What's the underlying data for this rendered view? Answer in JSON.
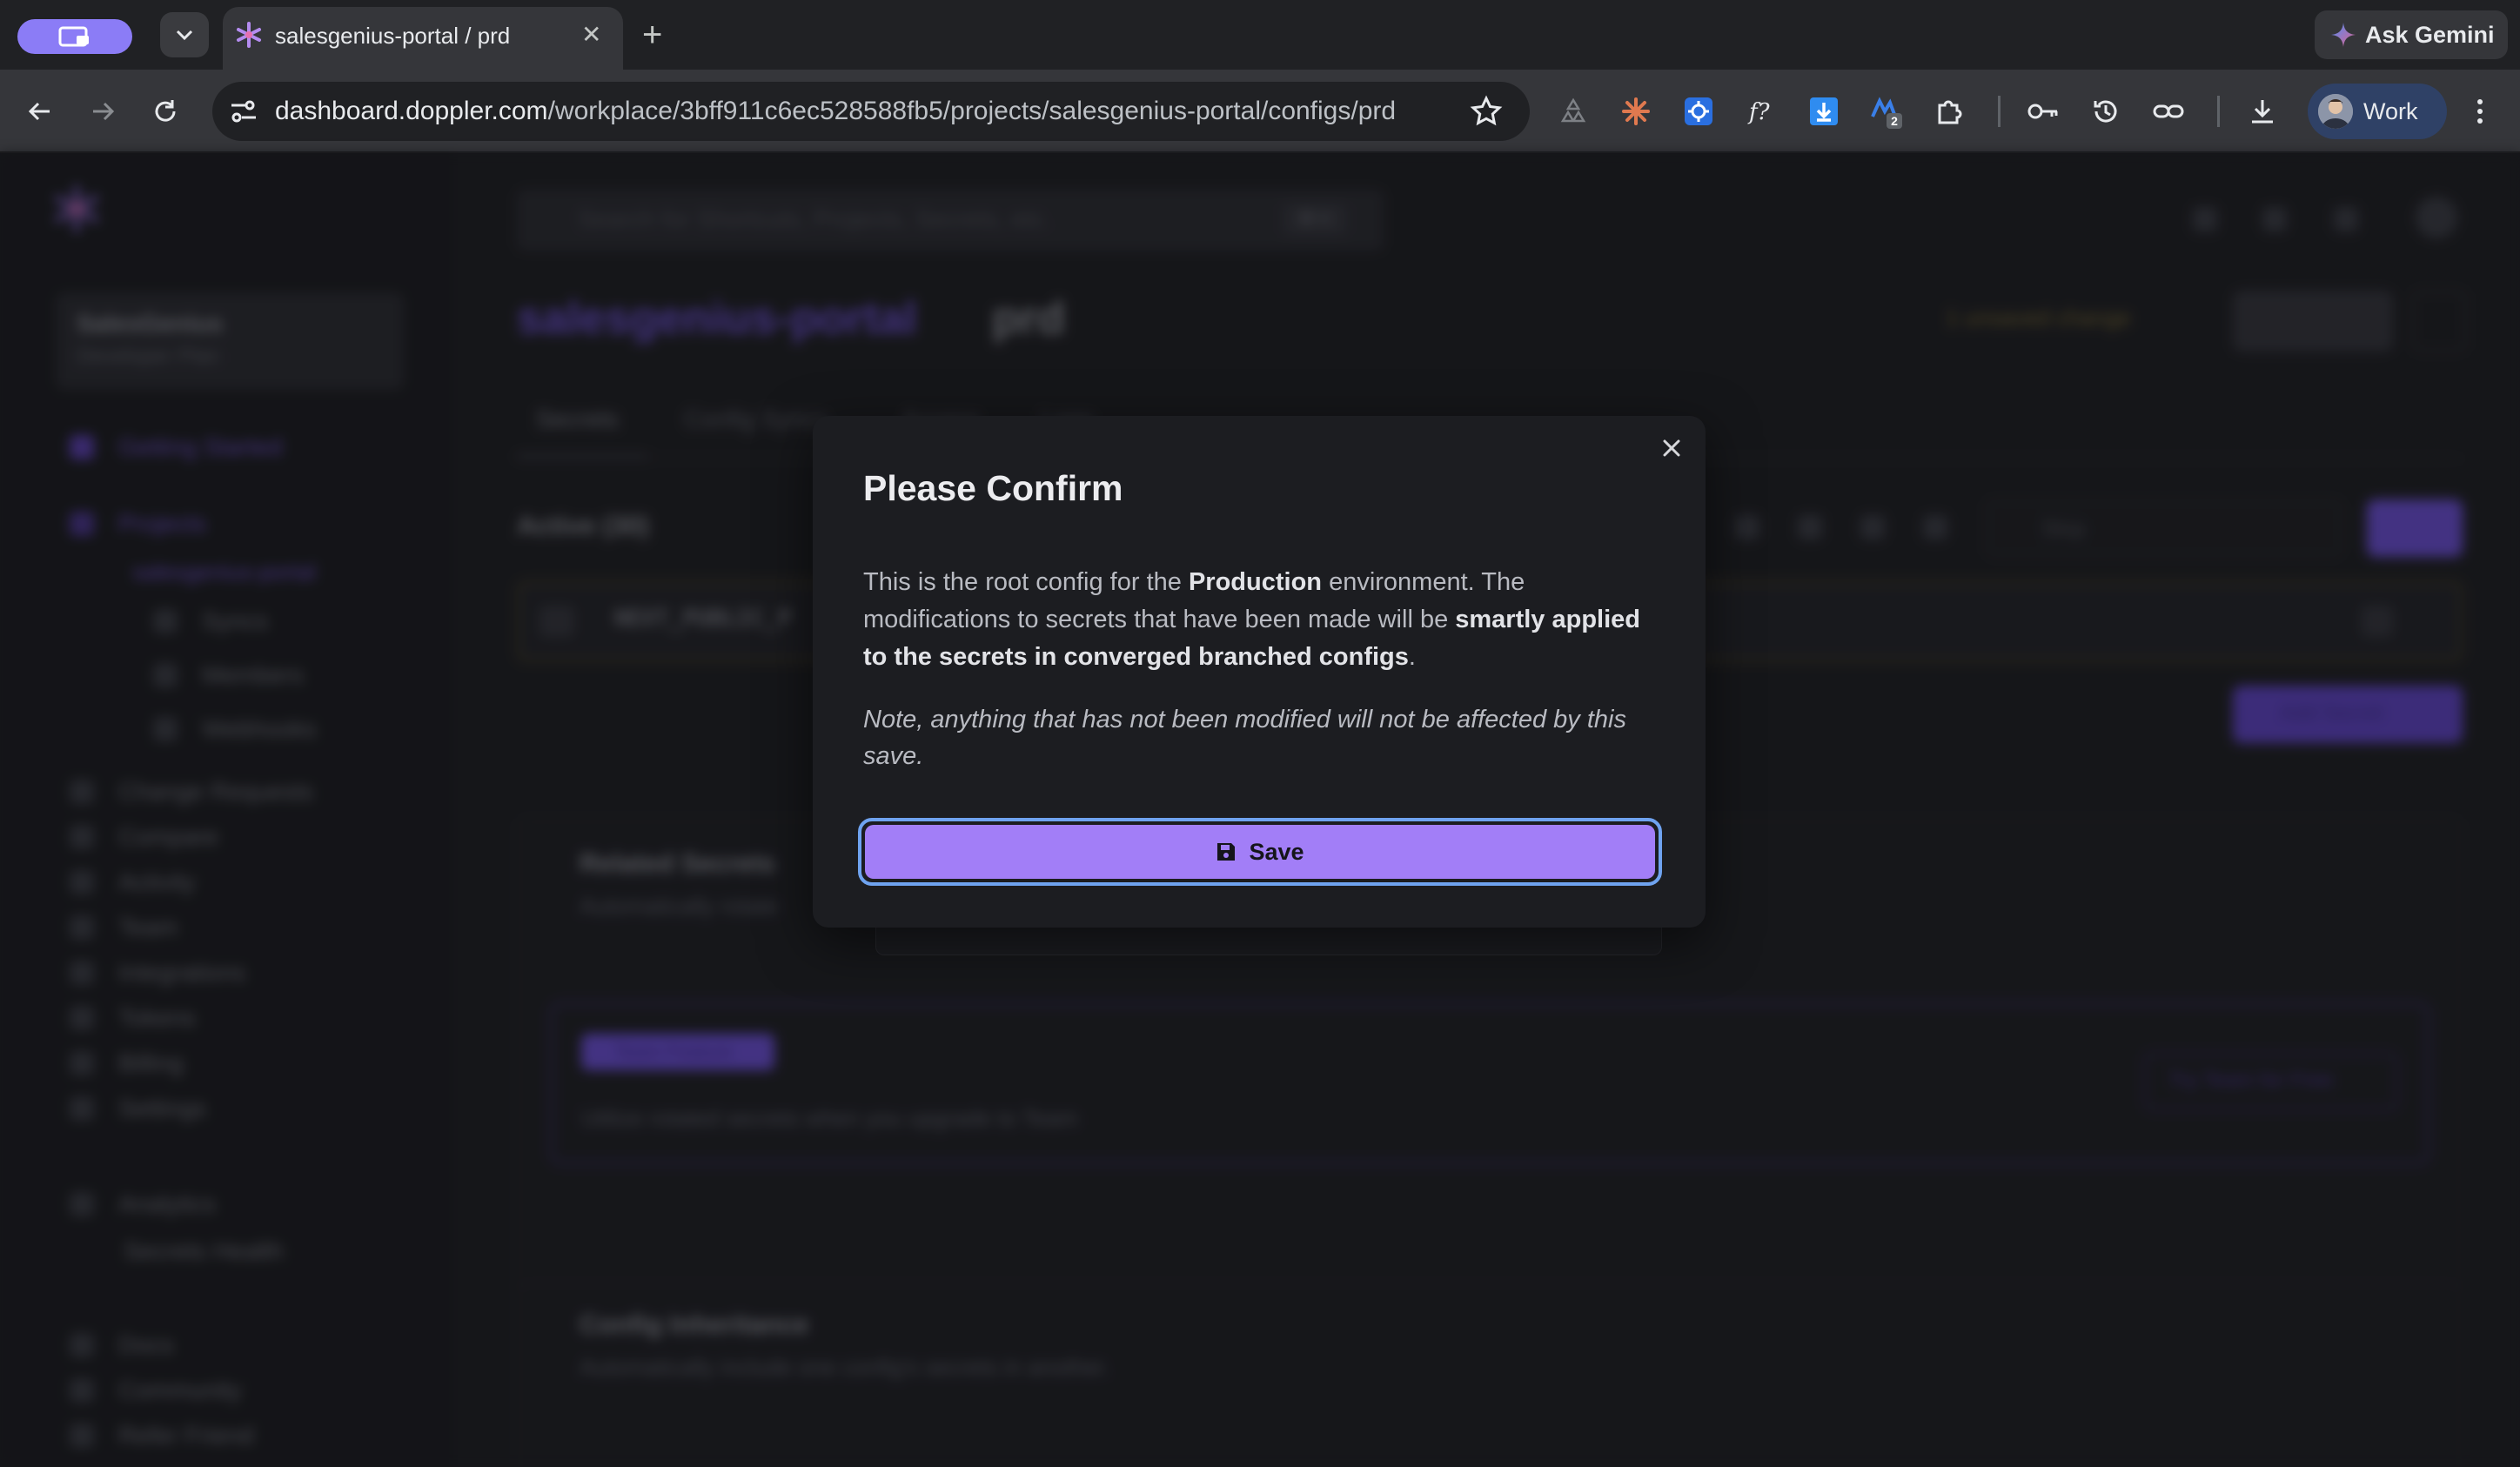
{
  "browser": {
    "tab": {
      "title": "salesgenius-portal / prd",
      "close_glyph": "✕"
    },
    "new_tab_glyph": "+",
    "gemini": {
      "label": "Ask Gemini"
    },
    "url": {
      "host": "dashboard.doppler.com",
      "path": "/workplace/3bff911c6ec528588fb5/projects/salesgenius-portal/configs/prd"
    },
    "profile": {
      "label": "Work"
    },
    "extension_badge": "2"
  },
  "app": {
    "search_placeholder": "Search for Shortcuts, Projects, Secrets, etc.",
    "search_shortcut": "⌘ K",
    "workspace": {
      "name": "SalesGenius",
      "plan": "Developer Plan"
    },
    "project": "salesgenius-portal",
    "config": "prd",
    "tabs": [
      "Secrets",
      "Config Syncs",
      "Access",
      "Logs"
    ],
    "active_count": "Active (30)",
    "secret_key": "NEXT_PUBLIC_P",
    "filter_placeholder": "Skip",
    "add_secret": "Add Secret",
    "unsaved_changes": "1 unsaved change",
    "nav": {
      "getting_started": "Getting Started",
      "projects": "Projects",
      "project_item": "salesgenius-portal",
      "sub_items": [
        "Syncs",
        "Members",
        "Webhooks"
      ],
      "items": [
        "Change Requests",
        "Compare",
        "Activity",
        "Team",
        "Integrations",
        "Tokens",
        "Billing",
        "Settings"
      ],
      "analytics": "Analytics",
      "secrets_health": "Secrets Health",
      "footer": [
        "Docs",
        "Community",
        "Refer Friend"
      ]
    },
    "related_secrets": {
      "title": "Related Secrets",
      "desc": "Automatically rotate"
    },
    "team_feature": {
      "badge": "Team Feature",
      "desc": "Utilize rotated secrets when you upgrade to Team",
      "cta": "Try Team for Free"
    },
    "inheritance": {
      "title": "Config Inheritance",
      "desc": "Automatically include one config's secrets in another."
    }
  },
  "modal": {
    "title": "Please Confirm",
    "body_prefix": "This is the root config for the ",
    "body_env": "Production",
    "body_mid": " environment. The modifications to secrets that have been made will be ",
    "body_strong": "smartly applied to the secrets in converged branched configs",
    "body_suffix": ".",
    "note": "Note, anything that has not been modified will not be affected by this save.",
    "save_label": "Save"
  }
}
